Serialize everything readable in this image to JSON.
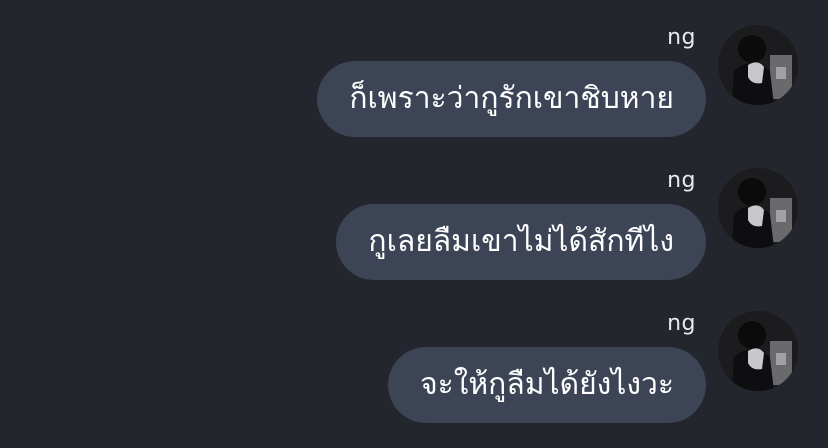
{
  "messages": [
    {
      "sender": "ng",
      "text": "ก็เพราะว่ากูรักเขาชิบหาย"
    },
    {
      "sender": "ng",
      "text": "กูเลยลืมเขาไม่ได้สักทีไง"
    },
    {
      "sender": "ng",
      "text": "จะให้กูลืมได้ยังไงวะ"
    }
  ],
  "colors": {
    "background": "#24262e",
    "bubble": "#3c4455",
    "text": "#ffffff",
    "sender": "#e9eaee"
  },
  "icons": {
    "avatar": "user-avatar-photo"
  }
}
